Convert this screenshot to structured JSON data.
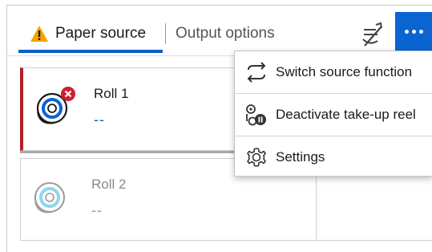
{
  "tabs": {
    "paper_source": "Paper source",
    "output_options": "Output options"
  },
  "rolls": [
    {
      "name": "Roll 1",
      "status": "--",
      "state": "error"
    },
    {
      "name": "Roll 2",
      "status": "--",
      "state": "inactive"
    }
  ],
  "menu": {
    "items": [
      {
        "label": "Switch source function",
        "icon": "switch-arrows-icon"
      },
      {
        "label": "Deactivate take-up reel",
        "icon": "take-up-reel-icon"
      },
      {
        "label": "Settings",
        "icon": "gear-icon"
      }
    ]
  },
  "colors": {
    "accent": "#0a64d2",
    "error": "#d01f2e",
    "warning": "#f5a300",
    "error_bar": "#b21e28"
  }
}
